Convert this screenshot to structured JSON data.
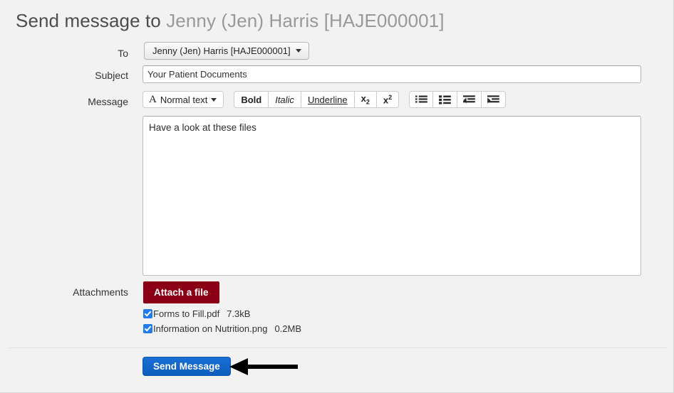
{
  "header": {
    "title_prefix": "Send message to",
    "recipient": "Jenny (Jen) Harris [HAJE000001]"
  },
  "form": {
    "to": {
      "label": "To",
      "value": "Jenny (Jen) Harris [HAJE000001]",
      "caret_icon": "chevron-down-icon"
    },
    "subject": {
      "label": "Subject",
      "value": "Your Patient Documents",
      "placeholder": ""
    },
    "message": {
      "label": "Message",
      "value": "Have a look at these files",
      "placeholder": ""
    },
    "attachments": {
      "label": "Attachments"
    }
  },
  "toolbar": {
    "style_select": {
      "icon": "font-A-icon",
      "label": "Normal text",
      "caret_icon": "chevron-down-icon"
    },
    "format_buttons": [
      {
        "name": "bold-button",
        "label": "Bold"
      },
      {
        "name": "italic-button",
        "label": "Italic"
      },
      {
        "name": "underline-button",
        "label": "Underline"
      },
      {
        "name": "subscript-button",
        "label": "x2"
      },
      {
        "name": "superscript-button",
        "label": "x2"
      }
    ],
    "list_buttons": [
      {
        "name": "bulleted-list-button",
        "icon": "bulleted-list-icon"
      },
      {
        "name": "numbered-list-button",
        "icon": "numbered-list-icon"
      },
      {
        "name": "outdent-button",
        "icon": "outdent-icon"
      },
      {
        "name": "indent-button",
        "icon": "indent-icon"
      }
    ]
  },
  "attachments": {
    "attach_button_label": "Attach a file",
    "files": [
      {
        "name": "Forms to Fill.pdf",
        "size": "7.3kB",
        "checked": true
      },
      {
        "name": "Information on Nutrition.png",
        "size": "0.2MB",
        "checked": true
      }
    ]
  },
  "footer": {
    "send_button_label": "Send Message",
    "annotation": "arrow-pointing-left"
  },
  "colors": {
    "page_background": "#f2f2f2",
    "title_text": "#4d4d4d",
    "title_recipient": "#999999",
    "attach_button": "#8b0015",
    "send_button": "#0d5dbd",
    "checkbox_checked": "#1f7ce8"
  }
}
